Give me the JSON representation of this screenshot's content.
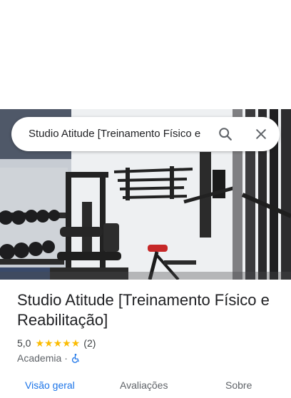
{
  "search": {
    "query": "Studio Atitude [Treinamento Físico e",
    "search_icon": "search-icon",
    "close_icon": "close-icon"
  },
  "photo": {
    "description_icon": "gym-photo"
  },
  "place": {
    "title": "Studio Atitude [Treinamento Físico e Reabilitação]",
    "rating": "5,0",
    "stars": 5,
    "review_count": "(2)",
    "category": "Academia",
    "separator": "·",
    "accessibility_icon": "wheelchair-icon"
  },
  "tabs": [
    {
      "label": "Visão geral",
      "active": true
    },
    {
      "label": "Avaliações",
      "active": false
    },
    {
      "label": "Sobre",
      "active": false
    }
  ],
  "colors": {
    "accent": "#1a73e8",
    "star": "#fbbc04",
    "text": "#202124",
    "secondary": "#5f6368"
  }
}
